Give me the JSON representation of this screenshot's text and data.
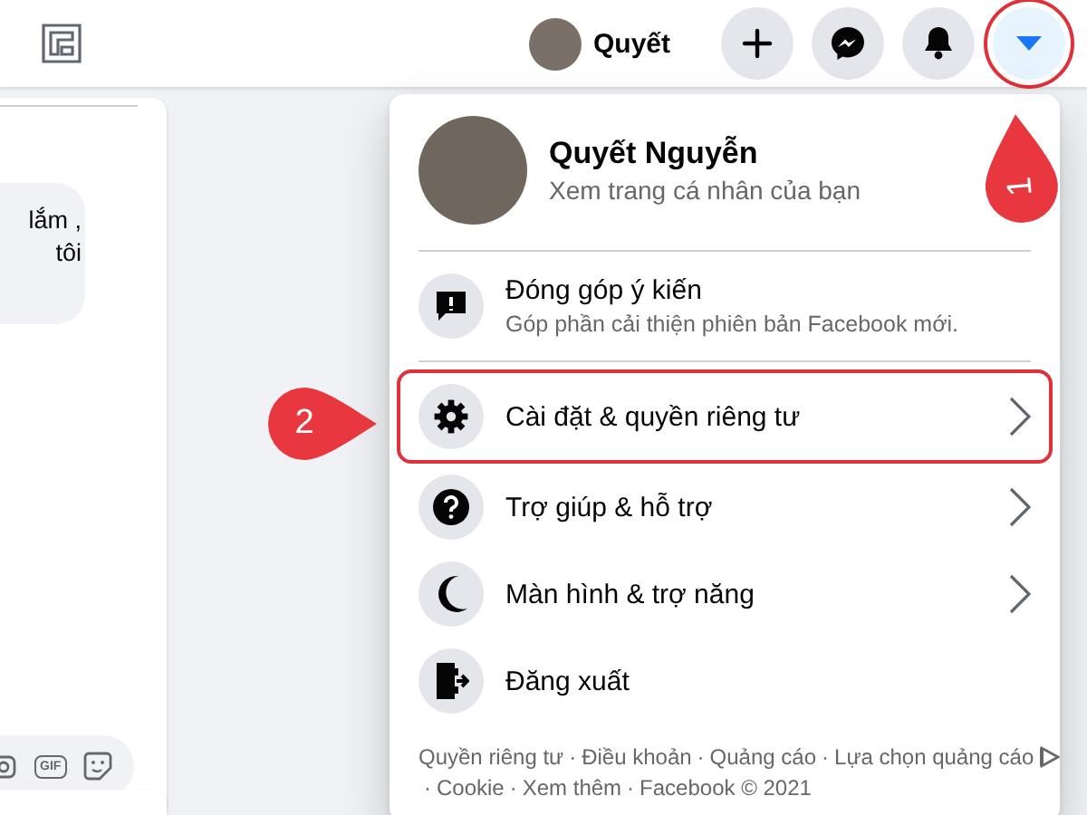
{
  "header": {
    "profile": {
      "name": "Quyết"
    },
    "buttons": [
      {
        "kind": "create",
        "selected": false,
        "highlighted": false
      },
      {
        "kind": "messenger",
        "selected": false,
        "highlighted": false
      },
      {
        "kind": "notifications",
        "selected": false,
        "highlighted": false
      },
      {
        "kind": "account",
        "selected": true,
        "highlighted": true
      }
    ]
  },
  "chat": {
    "message_lines": [
      "lắm ,",
      "tôi"
    ],
    "composer_icons": [
      {
        "kind": "camera"
      },
      {
        "kind": "gif",
        "label": "GIF"
      },
      {
        "kind": "sticker"
      }
    ]
  },
  "menu": {
    "profile": {
      "name": "Quyết Nguyễn",
      "subtitle": "Xem trang cá nhân của bạn"
    },
    "items": [
      {
        "kind": "feedback",
        "label": "Đóng góp ý kiến",
        "subtitle": "Góp phần cải thiện phiên bản Facebook mới.",
        "has_submenu": false,
        "highlighted": false
      },
      {
        "kind": "settings",
        "label": "Cài đặt & quyền riêng tư",
        "has_submenu": true,
        "highlighted": true
      },
      {
        "kind": "help",
        "label": "Trợ giúp & hỗ trợ",
        "has_submenu": true,
        "highlighted": false
      },
      {
        "kind": "display",
        "label": "Màn hình & trợ năng",
        "has_submenu": true,
        "highlighted": false
      },
      {
        "kind": "logout",
        "label": "Đăng xuất",
        "has_submenu": false,
        "highlighted": false
      }
    ],
    "footer": {
      "separator": "·",
      "links": [
        {
          "label": "Quyền riêng tư"
        },
        {
          "label": "Điều khoản"
        },
        {
          "label": "Quảng cáo"
        },
        {
          "label": "Lựa chọn quảng cáo",
          "ad_icon": true
        },
        {
          "label": "Cookie"
        },
        {
          "label": "Xem thêm"
        },
        {
          "label": "Facebook © 2021"
        }
      ]
    }
  },
  "annotations": [
    {
      "label": "1"
    },
    {
      "label": "2"
    }
  ]
}
